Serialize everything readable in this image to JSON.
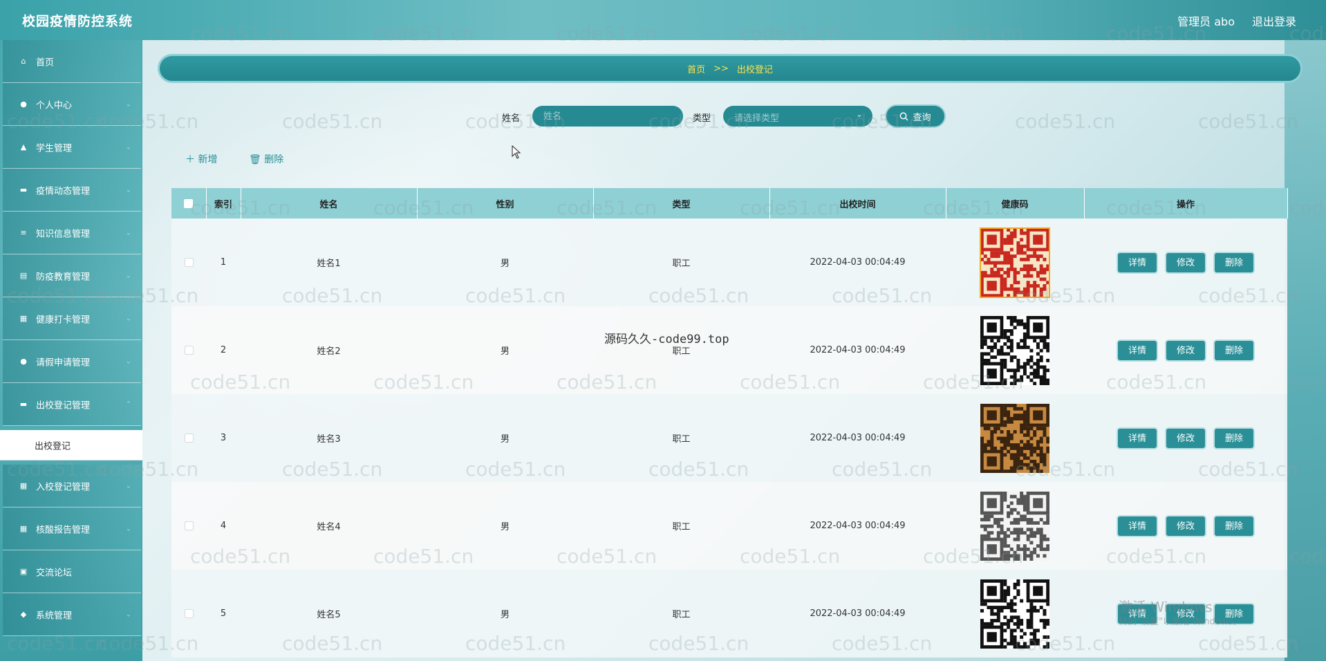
{
  "header": {
    "title": "校园疫情防控系统",
    "user": "管理员 abo",
    "logout": "退出登录"
  },
  "sidebar": {
    "items": [
      {
        "label": "首页",
        "icon": "home-icon",
        "glyph": "⌂",
        "arrow": ""
      },
      {
        "label": "个人中心",
        "icon": "user-icon",
        "glyph": "●",
        "arrow": "⌄"
      },
      {
        "label": "学生管理",
        "icon": "thumb-icon",
        "glyph": "▲",
        "arrow": "⌄"
      },
      {
        "label": "疫情动态管理",
        "icon": "monitor-icon",
        "glyph": "▬",
        "arrow": "⌄"
      },
      {
        "label": "知识信息管理",
        "icon": "list-icon",
        "glyph": "≡",
        "arrow": "⌄"
      },
      {
        "label": "防疫教育管理",
        "icon": "book-icon",
        "glyph": "▤",
        "arrow": "⌄"
      },
      {
        "label": "健康打卡管理",
        "icon": "grid-icon",
        "glyph": "▦",
        "arrow": "⌄"
      },
      {
        "label": "请假申请管理",
        "icon": "user-icon",
        "glyph": "●",
        "arrow": "⌄"
      },
      {
        "label": "出校登记管理",
        "icon": "comment-icon",
        "glyph": "▬",
        "arrow": "⌃"
      }
    ],
    "sub_active": "出校登记",
    "items_after": [
      {
        "label": "入校登记管理",
        "icon": "grid-icon",
        "glyph": "▦",
        "arrow": "⌄"
      },
      {
        "label": "核酸报告管理",
        "icon": "grid-icon",
        "glyph": "▦",
        "arrow": "⌄"
      },
      {
        "label": "交流论坛",
        "icon": "forum-icon",
        "glyph": "▣",
        "arrow": ""
      },
      {
        "label": "系统管理",
        "icon": "pin-icon",
        "glyph": "◆",
        "arrow": "⌄"
      }
    ]
  },
  "breadcrumb": {
    "home": "首页",
    "sep": ">>",
    "current": "出校登记"
  },
  "search": {
    "name_label": "姓名",
    "name_placeholder": "姓名",
    "type_label": "类型",
    "type_placeholder": "请选择类型",
    "query_label": "查询"
  },
  "actions": {
    "add": "新增",
    "delete": "删除"
  },
  "table": {
    "headers": [
      "索引",
      "姓名",
      "性别",
      "类型",
      "出校时间",
      "健康码",
      "操作"
    ],
    "rows": [
      {
        "index": "1",
        "name": "姓名1",
        "gender": "男",
        "type": "职工",
        "time": "2022-04-03 00:04:49"
      },
      {
        "index": "2",
        "name": "姓名2",
        "gender": "男",
        "type": "职工",
        "time": "2022-04-03 00:04:49"
      },
      {
        "index": "3",
        "name": "姓名3",
        "gender": "男",
        "type": "职工",
        "time": "2022-04-03 00:04:49"
      },
      {
        "index": "4",
        "name": "姓名4",
        "gender": "男",
        "type": "职工",
        "time": "2022-04-03 00:04:49"
      },
      {
        "index": "5",
        "name": "姓名5",
        "gender": "男",
        "type": "职工",
        "time": "2022-04-03 00:04:49"
      }
    ],
    "op_detail": "详情",
    "op_edit": "修改",
    "op_delete": "删除"
  },
  "watermark": {
    "text": "code51.cn",
    "center": "源码久久-code99.top",
    "windows_title": "激活 Windows",
    "windows_sub": "转到\"设置\"以激活 Windows。"
  },
  "colors": {
    "primary": "#258a92",
    "breadcrumb_text": "#ffe24a",
    "header_bg": "#3aa2aa",
    "table_header": "#8fd0d5"
  }
}
